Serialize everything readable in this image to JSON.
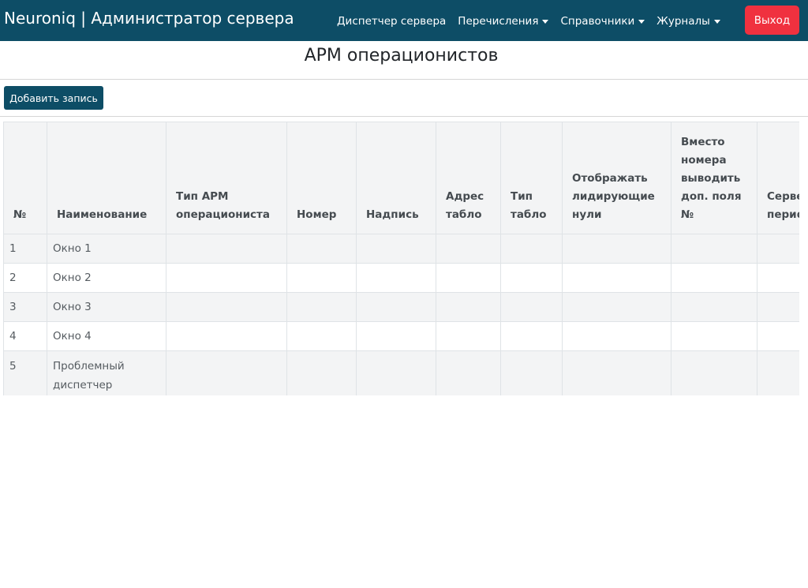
{
  "header": {
    "brand": "Neuroniq | Администратор сервера",
    "nav": [
      {
        "label": "Диспетчер сервера",
        "dropdown": false
      },
      {
        "label": "Перечисления",
        "dropdown": true
      },
      {
        "label": "Справочники",
        "dropdown": true
      },
      {
        "label": "Журналы",
        "dropdown": true
      }
    ],
    "logout_label": "Выход"
  },
  "page": {
    "title": "АРМ операционистов",
    "add_label": "Добавить запись"
  },
  "table": {
    "columns": [
      "№",
      "Наименование",
      "Тип АРМ операциониста",
      "Номер",
      "Надпись",
      "Адрес табло",
      "Тип табло",
      "Отображать лидирующие нули",
      "Вместо номера выводить доп. поля №",
      "Сервер периф..."
    ],
    "rows": [
      [
        "1",
        "Окно 1",
        "",
        "",
        "",
        "",
        "",
        "",
        "",
        ""
      ],
      [
        "2",
        "Окно 2",
        "",
        "",
        "",
        "",
        "",
        "",
        "",
        ""
      ],
      [
        "3",
        "Окно 3",
        "",
        "",
        "",
        "",
        "",
        "",
        "",
        ""
      ],
      [
        "4",
        "Окно 4",
        "",
        "",
        "",
        "",
        "",
        "",
        "",
        ""
      ],
      [
        "5",
        "Проблемный диспетчер",
        "",
        "",
        "",
        "",
        "",
        "",
        "",
        ""
      ]
    ]
  },
  "colors": {
    "navbar": "#0d4d66",
    "logout": "#f0313f",
    "primary_button": "#0d4d66"
  }
}
